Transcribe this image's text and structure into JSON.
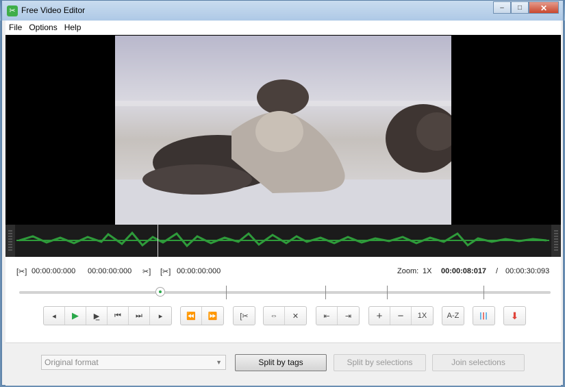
{
  "window": {
    "title": "Free Video Editor",
    "minimize": "–",
    "maximize": "□",
    "close": "✕"
  },
  "menu": [
    "File",
    "Options",
    "Help"
  ],
  "times": {
    "sel_start": "00:00:00:000",
    "sel_end": "00:00:00:000",
    "sel_length": "00:00:00:000",
    "zoom_label": "Zoom:",
    "zoom_value": "1X",
    "current": "00:00:08:017",
    "separator": "/",
    "total": "00:00:30:093"
  },
  "playback": {
    "position_fraction": 0.27
  },
  "toolbar": {
    "zoom_reset_label": "1X",
    "sort_label": "A-Z"
  },
  "bottom": {
    "format_value": "Original format",
    "split_tags_label": "Split by tags",
    "split_sel_label": "Split by selections",
    "join_sel_label": "Join selections"
  },
  "colors": {
    "accent_green": "#2aa84a",
    "waveform": "#2e9b3a",
    "export_red": "#e0443a",
    "markers_blue": "#3aa0e0"
  }
}
